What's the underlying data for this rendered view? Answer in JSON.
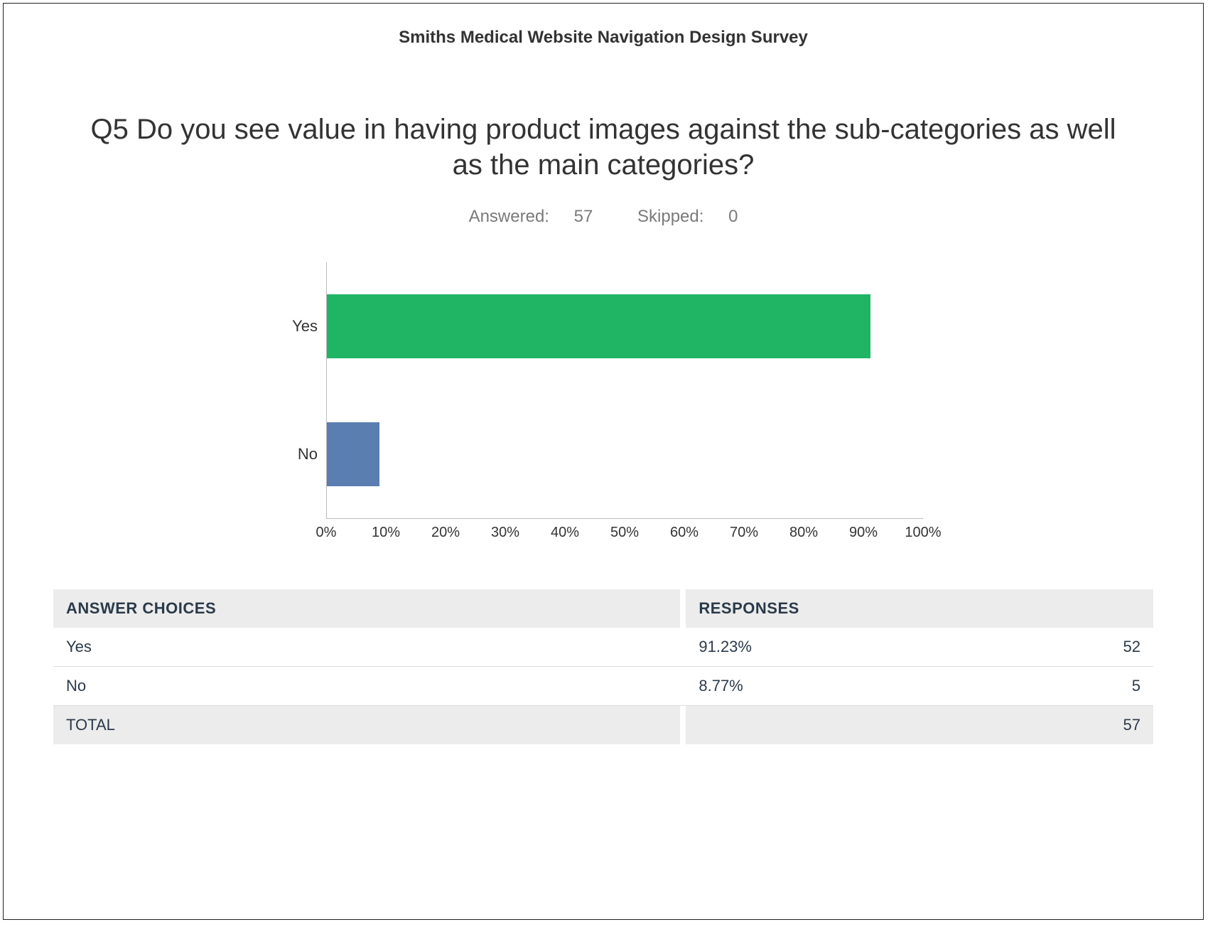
{
  "survey_title": "Smiths Medical Website Navigation Design Survey",
  "question": "Q5 Do you see value in having product images against the sub-categories as well as the main categories?",
  "meta": {
    "answered_label": "Answered:",
    "answered_count": "57",
    "skipped_label": "Skipped:",
    "skipped_count": "0"
  },
  "table": {
    "header_choices": "ANSWER CHOICES",
    "header_responses": "RESPONSES",
    "rows": [
      {
        "label": "Yes",
        "pct": "91.23%",
        "count": "52"
      },
      {
        "label": "No",
        "pct": "8.77%",
        "count": "5"
      }
    ],
    "total_label": "TOTAL",
    "total_count": "57"
  },
  "chart_data": {
    "type": "bar",
    "orientation": "horizontal",
    "categories": [
      "Yes",
      "No"
    ],
    "values": [
      91.23,
      8.77
    ],
    "colors": [
      "#1fb564",
      "#5a7eb0"
    ],
    "xlabel": "",
    "ylabel": "",
    "xlim": [
      0,
      100
    ],
    "ticks": [
      0,
      10,
      20,
      30,
      40,
      50,
      60,
      70,
      80,
      90,
      100
    ],
    "tick_labels": [
      "0%",
      "10%",
      "20%",
      "30%",
      "40%",
      "50%",
      "60%",
      "70%",
      "80%",
      "90%",
      "100%"
    ]
  }
}
